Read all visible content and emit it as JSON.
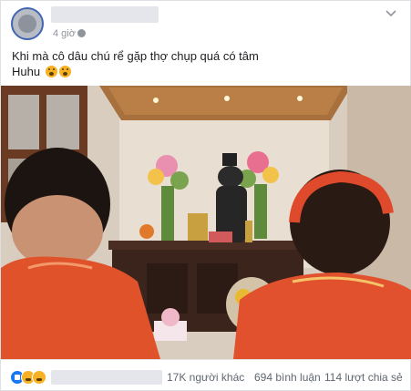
{
  "header": {
    "timestamp": "4 giờ"
  },
  "post": {
    "text_line1": "Khi mà cô dâu chú rể gặp thợ chụp quá có tâm",
    "text_line2": "Huhu"
  },
  "footer": {
    "others": "17K người khác",
    "comments": "694 bình luận",
    "shares": "114 lượt chia sẻ"
  },
  "colors": {
    "brand_blue": "#4267b2",
    "like_blue": "#1877f2",
    "reaction_yellow": "#f7b125",
    "meta_gray": "#90949c"
  }
}
